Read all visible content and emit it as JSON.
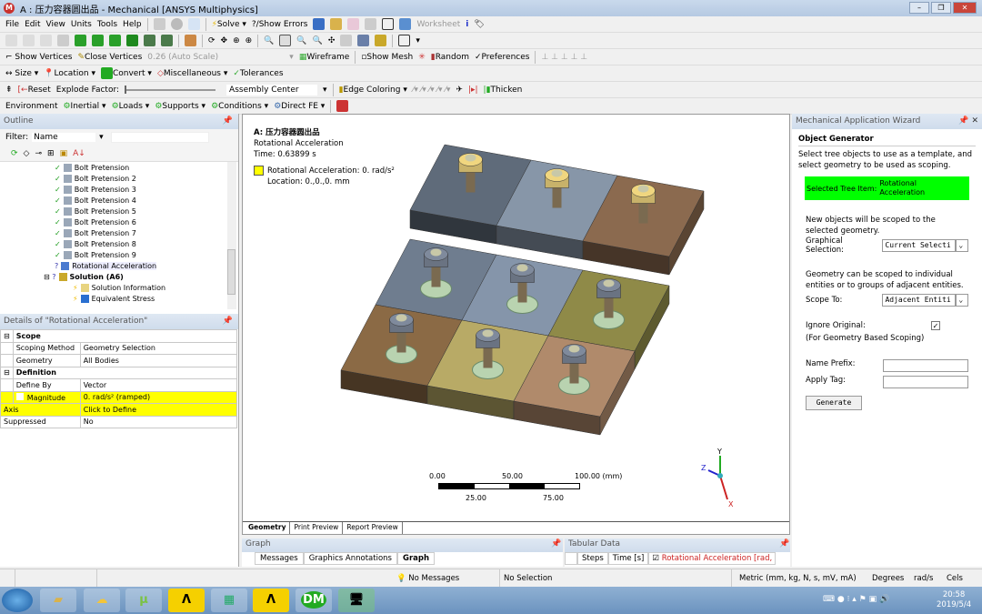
{
  "window": {
    "title": "A : 压力容器圆出品 - Mechanical [ANSYS Multiphysics]",
    "logo": "M"
  },
  "menu": [
    "File",
    "Edit",
    "View",
    "Units",
    "Tools",
    "Help"
  ],
  "toolbar1": {
    "solve": "Solve",
    "show_errors": "?/Show Errors",
    "worksheet": "Worksheet"
  },
  "toolbar3": {
    "show_vertices": "Show Vertices",
    "close_vertices": "Close Vertices",
    "scale": "0.26 (Auto Scale)",
    "wireframe": "Wireframe",
    "show_mesh": "Show Mesh",
    "random": "Random",
    "preferences": "Preferences"
  },
  "toolbar4": {
    "size": "Size",
    "location": "Location",
    "convert": "Convert",
    "misc": "Miscellaneous",
    "tolerances": "Tolerances"
  },
  "toolbar5": {
    "reset": "Reset",
    "explode": "Explode Factor:",
    "assembly": "Assembly Center",
    "edge_coloring": "Edge Coloring",
    "thicken": "Thicken"
  },
  "toolbar6": {
    "environment": "Environment",
    "inertial": "Inertial",
    "loads": "Loads",
    "supports": "Supports",
    "conditions": "Conditions",
    "direct_fe": "Direct FE"
  },
  "outline": {
    "title": "Outline",
    "filter_label": "Filter:",
    "filter_value": "Name",
    "items": [
      "Bolt Pretension",
      "Bolt Pretension 2",
      "Bolt Pretension 3",
      "Bolt Pretension 4",
      "Bolt Pretension 5",
      "Bolt Pretension 6",
      "Bolt Pretension 7",
      "Bolt Pretension 8",
      "Bolt Pretension 9"
    ],
    "rot": "Rotational Acceleration",
    "solution": "Solution (A6)",
    "sol_info": "Solution Information",
    "eq_stress": "Equivalent Stress"
  },
  "details": {
    "title": "Details of \"Rotational Acceleration\"",
    "rows": [
      [
        "Scope",
        ""
      ],
      [
        "Scoping Method",
        "Geometry Selection"
      ],
      [
        "Geometry",
        "All Bodies"
      ],
      [
        "Definition",
        ""
      ],
      [
        "Define By",
        "Vector"
      ],
      [
        "Magnitude",
        "0. rad/s²  (ramped)"
      ],
      [
        "Axis",
        "Click to Define"
      ],
      [
        "Suppressed",
        "No"
      ]
    ]
  },
  "viewport": {
    "title": "A: 压力容器圆出品",
    "subtitle": "Rotational Acceleration",
    "time": "Time: 0.63899 s",
    "legend": "Rotational Acceleration: 0. rad/s²",
    "location": "Location: 0.,0.,0. mm",
    "scale": {
      "top": [
        "0.00",
        "50.00",
        "100.00 (mm)"
      ],
      "bottom": [
        "25.00",
        "75.00"
      ]
    },
    "axes": {
      "x": "X",
      "y": "Y",
      "z": "Z"
    },
    "tabs": [
      "Geometry",
      "Print Preview",
      "Report Preview"
    ]
  },
  "graph": {
    "title": "Graph",
    "tabs": [
      "Messages",
      "Graphics Annotations",
      "Graph"
    ]
  },
  "tabular": {
    "title": "Tabular Data",
    "cols": [
      "Steps",
      "Time [s]",
      "Rotational Acceleration [rad,"
    ]
  },
  "wizard": {
    "title": "Mechanical Application Wizard",
    "heading": "Object Generator",
    "intro": "Select tree objects to use as a template, and select geometry to be used as scoping.",
    "sel_label": "Selected Tree Item:",
    "sel_value": "Rotational Acceleration",
    "new_obj": "New objects will be scoped to the selected geometry.",
    "graph_sel_label": "Graphical Selection:",
    "graph_sel_value": "Current Selecti",
    "geom_text": "Geometry can be scoped to individual entities or to groups of adjacent entities.",
    "scope_label": "Scope To:",
    "scope_value": "Adjacent Entiti",
    "ignore_label": "Ignore Original:",
    "ignore_note": "(For Geometry Based Scoping)",
    "prefix_label": "Name Prefix:",
    "tag_label": "Apply Tag:",
    "generate": "Generate"
  },
  "status": {
    "messages": "No Messages",
    "selection": "No Selection",
    "units": "Metric (mm, kg, N, s, mV, mA)",
    "angle": "Degrees",
    "rate": "rad/s",
    "temp": "Cels"
  },
  "taskbar": {
    "time": "20:58",
    "date": "2019/5/4",
    "apps": [
      "DM"
    ]
  }
}
